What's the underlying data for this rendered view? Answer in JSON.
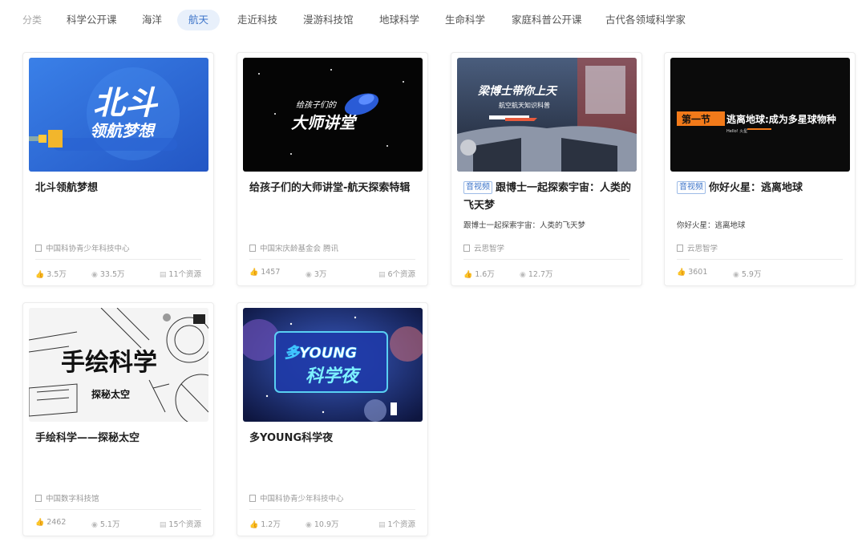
{
  "categories": {
    "label": "分类",
    "items": [
      "科学公开课",
      "海洋",
      "航天",
      "走近科技",
      "漫游科技馆",
      "地球科学",
      "生命科学",
      "家庭科普公开课",
      "古代各领域科学家"
    ],
    "active_index": 2
  },
  "cards": [
    {
      "title": "北斗领航梦想",
      "tag": "",
      "subtitle": "",
      "source": "中国科协青少年科技中心",
      "likes": "3.5万",
      "views": "33.5万",
      "resources": "11个资源",
      "thumb": {
        "text_main": "北斗",
        "text_sub": "领航梦想",
        "bg": "#2f6fd8"
      }
    },
    {
      "title": "给孩子们的大师讲堂-航天探索特辑",
      "tag": "",
      "subtitle": "",
      "source": "中国宋庆龄基金会 腾讯",
      "likes": "1457",
      "views": "3万",
      "resources": "6个资源",
      "thumb": {
        "text_main": "大师讲堂",
        "text_sub": "给孩子们的",
        "bg": "#050505"
      }
    },
    {
      "title": "跟博士一起探索宇宙：人类的飞天梦",
      "tag": "音视频",
      "subtitle": "跟博士一起探索宇宙：人类的飞天梦",
      "source": "云思智学",
      "likes": "1.6万",
      "views": "12.7万",
      "resources": "",
      "thumb": {
        "text_main": "梁博士带你上天",
        "text_sub": "航空航天知识科普",
        "bg": "#3b4a63"
      }
    },
    {
      "title": "你好火星：逃离地球",
      "tag": "音视频",
      "subtitle": "你好火星：逃离地球",
      "source": "云思智学",
      "likes": "3601",
      "views": "5.9万",
      "resources": "",
      "thumb": {
        "text_main": "逃离地球:成为多星球物种",
        "text_sub": "第一节",
        "text_small": "Hello! 火星",
        "bg": "#0b0b0b"
      }
    },
    {
      "title": "手绘科学——探秘太空",
      "tag": "",
      "subtitle": "",
      "source": "中国数字科技馆",
      "likes": "2462",
      "views": "5.1万",
      "resources": "15个资源",
      "thumb": {
        "text_main": "手绘科学",
        "text_sub": "探秘太空",
        "bg": "#f4f4f4"
      }
    },
    {
      "title": "多YOUNG科学夜",
      "tag": "",
      "subtitle": "",
      "source": "中国科协青少年科技中心",
      "likes": "1.2万",
      "views": "10.9万",
      "resources": "1个资源",
      "thumb": {
        "text_main": "多YOUNG",
        "text_sub": "科学夜",
        "bg": "#1a2a6b"
      }
    }
  ],
  "icons": {
    "source": "document-icon",
    "likes": "thumb-up-icon",
    "views": "eye-icon",
    "resources": "file-icon"
  },
  "colors": {
    "accent": "#3b73c9",
    "active_bg": "#e8f0fb"
  }
}
